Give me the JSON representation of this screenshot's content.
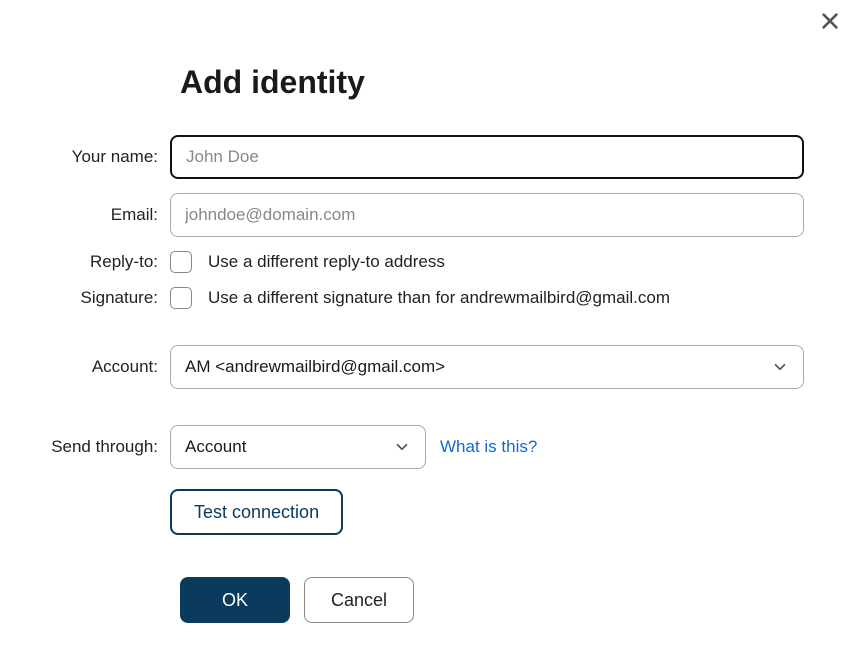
{
  "dialog": {
    "title": "Add identity"
  },
  "fields": {
    "name": {
      "label": "Your name:",
      "value": "",
      "placeholder": "John Doe"
    },
    "email": {
      "label": "Email:",
      "value": "",
      "placeholder": "johndoe@domain.com"
    },
    "replyTo": {
      "label": "Reply-to:",
      "text": "Use a different reply-to address"
    },
    "signature": {
      "label": "Signature:",
      "text": "Use a different signature than for andrewmailbird@gmail.com"
    },
    "account": {
      "label": "Account:",
      "selected": "AM <andrewmailbird@gmail.com>"
    },
    "sendThrough": {
      "label": "Send through:",
      "selected": "Account",
      "helpLink": "What is this?"
    }
  },
  "buttons": {
    "testConnection": "Test connection",
    "ok": "OK",
    "cancel": "Cancel"
  }
}
